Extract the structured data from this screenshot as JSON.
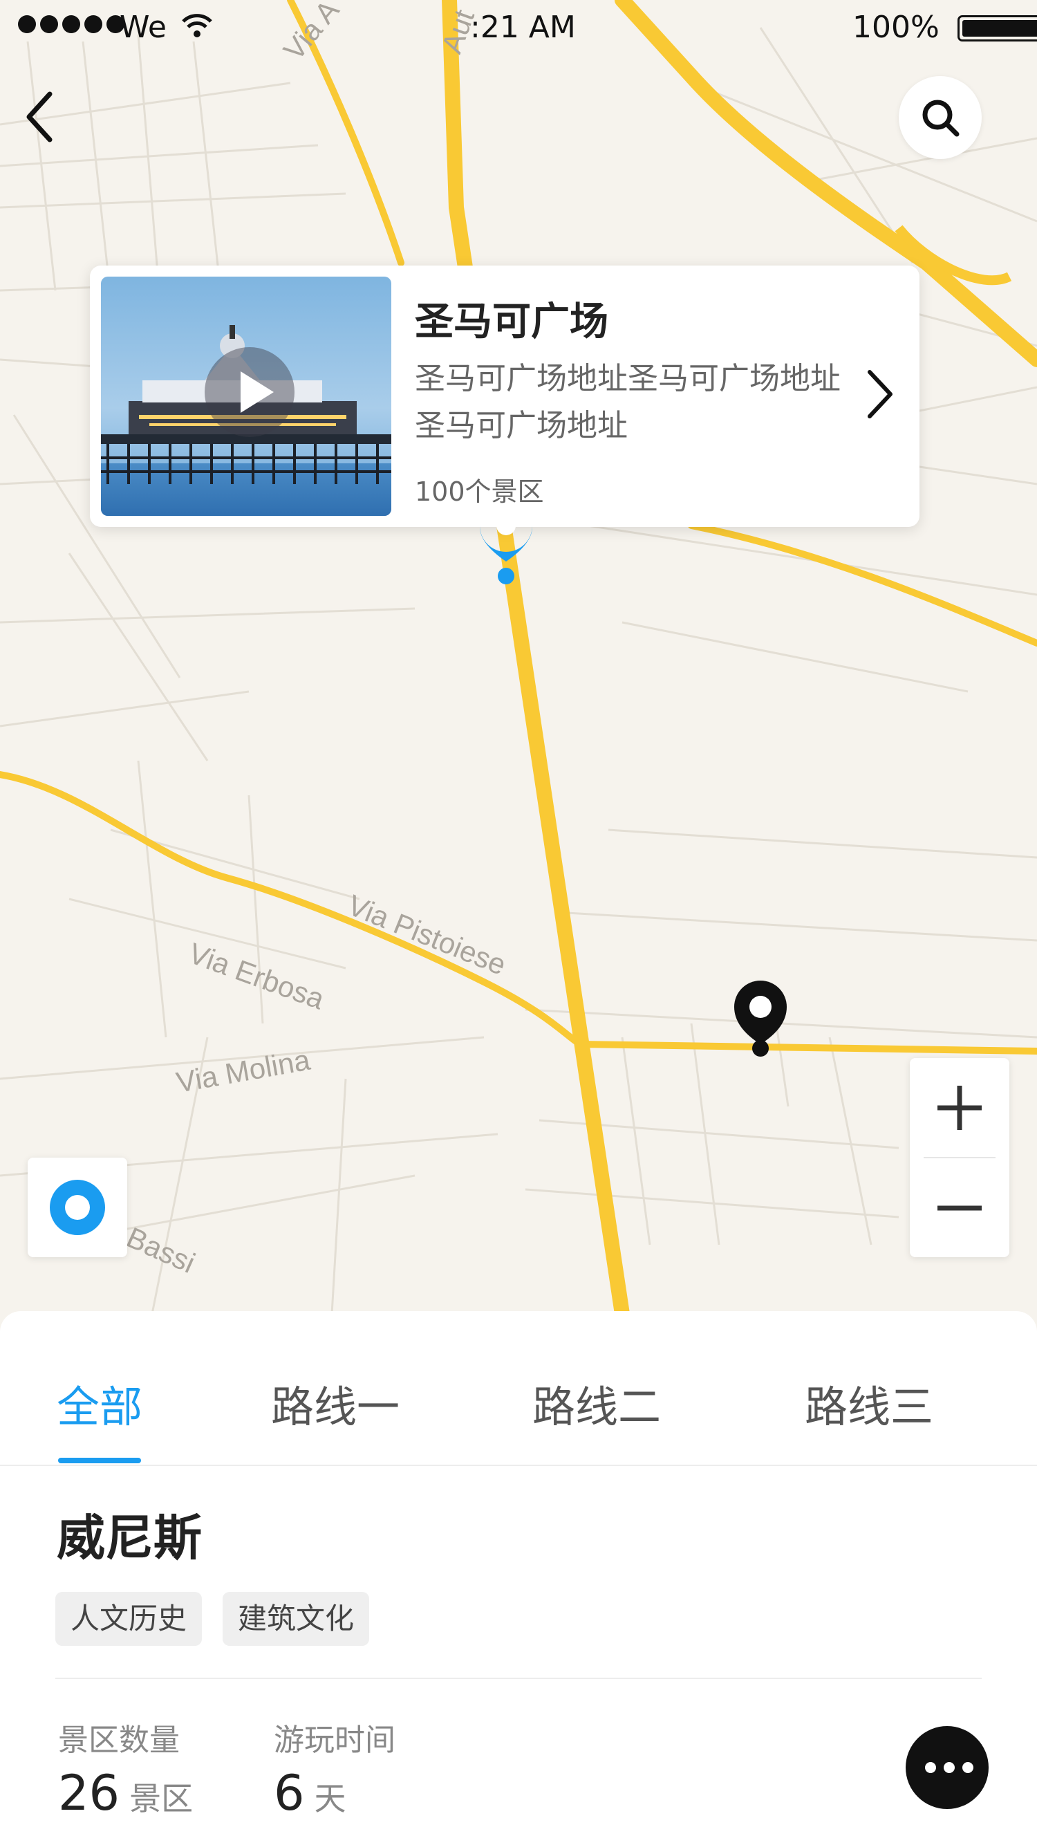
{
  "status_bar": {
    "carrier": "We",
    "time": ":21 AM",
    "battery": "100%"
  },
  "map": {
    "road_labels": [
      "Via Pistoiese",
      "Via Erbosa",
      "Via Molina",
      "Bassi",
      "Via A",
      "Aut"
    ],
    "road_color": "#f9c934",
    "pin_color": "#1a9cf0"
  },
  "poi_card": {
    "title": "圣马可广场",
    "address": "圣马可广场地址圣马可广场地址圣马可广场地址",
    "count": "100个景区"
  },
  "icons": {
    "back": "chevron-left-icon",
    "search": "search-icon",
    "play": "play-icon",
    "arrow": "chevron-right-icon",
    "zoom_in": "plus-icon",
    "zoom_out": "minus-icon",
    "locate": "locate-icon",
    "more": "more-icon"
  },
  "tabs": [
    "全部",
    "路线一",
    "路线二",
    "路线三"
  ],
  "active_tab": 0,
  "city": {
    "name": "威尼斯",
    "tags": [
      "人文历史",
      "建筑文化"
    ],
    "stats": [
      {
        "label": "景区数量",
        "value": "26",
        "unit": "景区"
      },
      {
        "label": "游玩时间",
        "value": "6",
        "unit": "天"
      }
    ]
  },
  "accent_color": "#1a9cf0"
}
